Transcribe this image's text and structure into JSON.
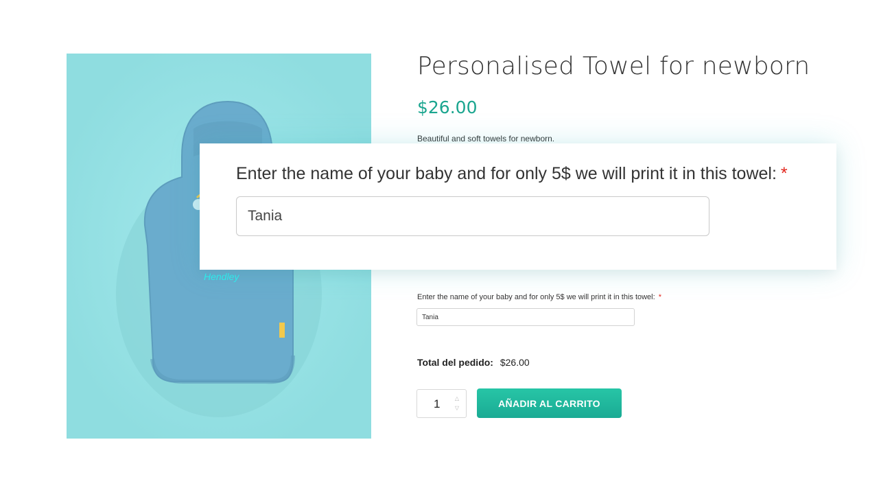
{
  "product": {
    "title": "Personalised Towel for newborn",
    "price": "$26.00",
    "description": "Beautiful and soft towels for newborn.",
    "image": {
      "embroidered_name": "Hendley",
      "background_color": "#8fdde0",
      "towel_color": "#6aaccd"
    }
  },
  "zoom_callout": {
    "label": "Enter the name of your baby and for only 5$ we will print it in this towel:",
    "required_mark": "*",
    "value": "Tania"
  },
  "name_field": {
    "label": "Enter the name of your baby and for only 5$ we will print it in this towel:",
    "required_mark": "*",
    "value": "Tania"
  },
  "order": {
    "total_label": "Total del pedido:",
    "total_value": "$26.00"
  },
  "quantity": {
    "value": "1",
    "up_icon": "chevron-up-icon",
    "down_icon": "chevron-down-icon"
  },
  "add_to_cart": {
    "label": "AÑADIR AL CARRITO"
  },
  "colors": {
    "accent": "#1aa58f",
    "required": "#e2261d"
  }
}
